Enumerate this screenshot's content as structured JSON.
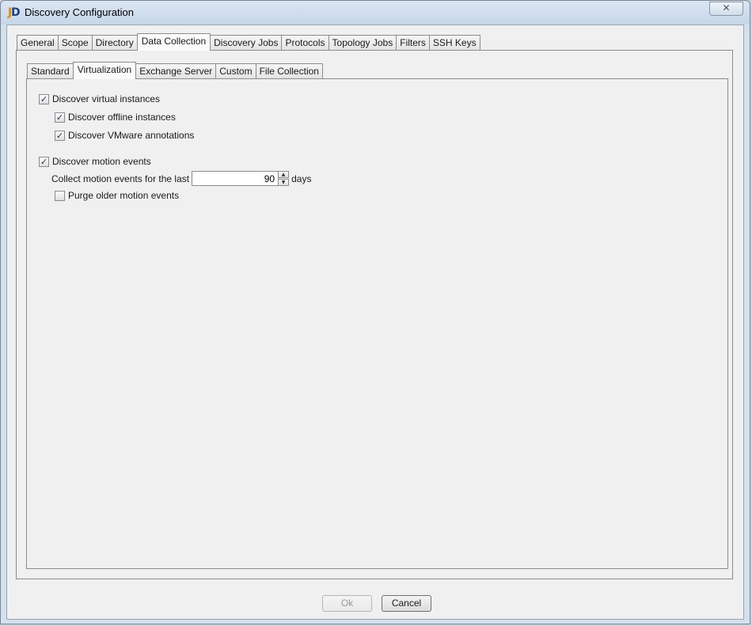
{
  "window": {
    "title": "Discovery Configuration",
    "close_glyph": "✕"
  },
  "outer_tabs": [
    {
      "label": "General",
      "active": false
    },
    {
      "label": "Scope",
      "active": false
    },
    {
      "label": "Directory",
      "active": false
    },
    {
      "label": "Data Collection",
      "active": true
    },
    {
      "label": "Discovery Jobs",
      "active": false
    },
    {
      "label": "Protocols",
      "active": false
    },
    {
      "label": "Topology Jobs",
      "active": false
    },
    {
      "label": "Filters",
      "active": false
    },
    {
      "label": "SSH Keys",
      "active": false
    }
  ],
  "inner_tabs": [
    {
      "label": "Standard",
      "active": false
    },
    {
      "label": "Virtualization",
      "active": true
    },
    {
      "label": "Exchange Server",
      "active": false
    },
    {
      "label": "Custom",
      "active": false
    },
    {
      "label": "File Collection",
      "active": false
    }
  ],
  "options": {
    "discover_virtual": {
      "label": "Discover virtual instances",
      "checked": true
    },
    "discover_offline": {
      "label": "Discover offline instances",
      "checked": true
    },
    "discover_vmware_annotations": {
      "label": "Discover VMware annotations",
      "checked": true
    },
    "discover_motion": {
      "label": "Discover motion events",
      "checked": true
    },
    "collect_motion": {
      "label": "Collect motion events for the last",
      "value": "90",
      "unit": "days"
    },
    "purge_older": {
      "label": "Purge older motion events",
      "checked": false
    }
  },
  "buttons": {
    "ok": {
      "label": "Ok",
      "enabled": false
    },
    "cancel": {
      "label": "Cancel",
      "enabled": true
    }
  },
  "icons": {
    "check_glyph": "✓",
    "spin_up": "▲",
    "spin_down": "▼"
  }
}
